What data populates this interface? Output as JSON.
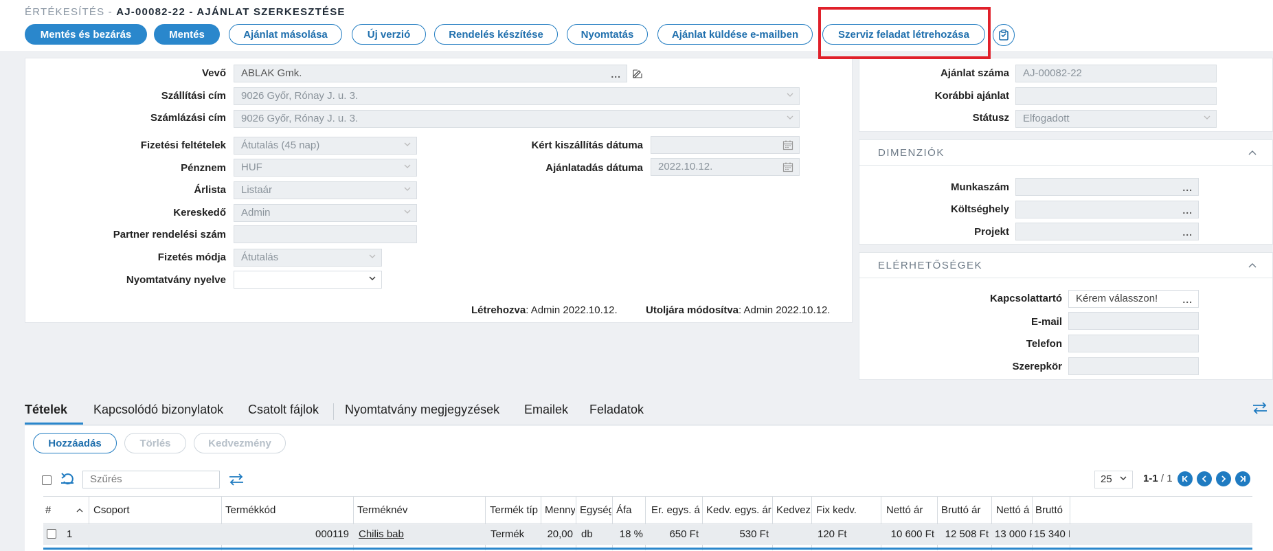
{
  "header": {
    "module": "ÉRTÉKESÍTÉS -",
    "title": "AJ-00082-22 - AJÁNLAT SZERKESZTÉSE"
  },
  "toolbar": {
    "save_close": "Mentés és bezárás",
    "save": "Mentés",
    "copy": "Ajánlat másolása",
    "new_version": "Új verzió",
    "create_order": "Rendelés készítése",
    "print": "Nyomtatás",
    "send_email": "Ajánlat küldése e-mailben",
    "service_task": "Szerviz feladat létrehozása"
  },
  "form": {
    "customer_label": "Vevő",
    "customer_value": "ABLAK Gmk.",
    "shipping_label": "Szállítási cím",
    "shipping_value": "9026 Győr, Rónay J. u. 3.",
    "billing_label": "Számlázási cím",
    "billing_value": "9026 Győr, Rónay J. u. 3.",
    "payment_terms_label": "Fizetési feltételek",
    "payment_terms_value": "Átutalás (45 nap)",
    "currency_label": "Pénznem",
    "currency_value": "HUF",
    "pricelist_label": "Árlista",
    "pricelist_value": "Listaár",
    "salesperson_label": "Kereskedő",
    "salesperson_value": "Admin",
    "partner_order_label": "Partner rendelési szám",
    "partner_order_value": "",
    "payment_method_label": "Fizetés módja",
    "payment_method_value": "Átutalás",
    "print_language_label": "Nyomtatvány nyelve",
    "print_language_value": "",
    "requested_delivery_label": "Kért kiszállítás dátuma",
    "requested_delivery_value": "",
    "offer_date_label": "Ajánlatadás dátuma",
    "offer_date_value": "2022.10.12.",
    "created_label": "Létrehozva",
    "created_value": ": Admin 2022.10.12.",
    "modified_label": "Utoljára módosítva",
    "modified_value": ": Admin 2022.10.12."
  },
  "right_panel": {
    "offer_number_label": "Ajánlat száma",
    "offer_number_value": "AJ-00082-22",
    "previous_offer_label": "Korábbi ajánlat",
    "previous_offer_value": "",
    "status_label": "Státusz",
    "status_value": "Elfogadott",
    "dimensions_title": "DIMENZIÓK",
    "job_number_label": "Munkaszám",
    "cost_center_label": "Költséghely",
    "project_label": "Projekt",
    "contacts_title": "ELÉRHETŐSÉGEK",
    "contact_label": "Kapcsolattartó",
    "contact_value": "Kérem válasszon!",
    "email_label": "E-mail",
    "phone_label": "Telefon",
    "role_label": "Szerepkör"
  },
  "tabs": [
    "Tételek",
    "Kapcsolódó bizonylatok",
    "Csatolt fájlok",
    "Nyomtatvány megjegyzések",
    "Emailek",
    "Feladatok"
  ],
  "grid_toolbar": {
    "add": "Hozzáadás",
    "delete": "Törlés",
    "discount": "Kedvezmény",
    "filter_placeholder": "Szűrés",
    "page_size": "25",
    "page_range": "1-1",
    "page_total": " / 1"
  },
  "columns": [
    "#",
    "Csoport",
    "Termékkód",
    "Terméknév",
    "Termék típ",
    "Menny",
    "Egység",
    "Áfa",
    "Er. egys. á",
    "Kedv. egys. ár",
    "Kedvez",
    "Fix kedv.",
    "Nettó ár",
    "Bruttó ár",
    "Nettó á",
    "Bruttó"
  ],
  "rows": [
    {
      "num": "1",
      "group": "",
      "code": "000119",
      "name": "Chilis bab",
      "type": "Termék",
      "qty": "20,00",
      "unit": "db",
      "vat": "18 %",
      "unit_price": "650 Ft",
      "disc_unit_price": "530 Ft",
      "disc": "",
      "fix_disc": "120 Ft",
      "net": "10 600 Ft",
      "gross": "12 508 Ft",
      "net2": "13 000 F",
      "gross2": "15 340 F"
    }
  ]
}
